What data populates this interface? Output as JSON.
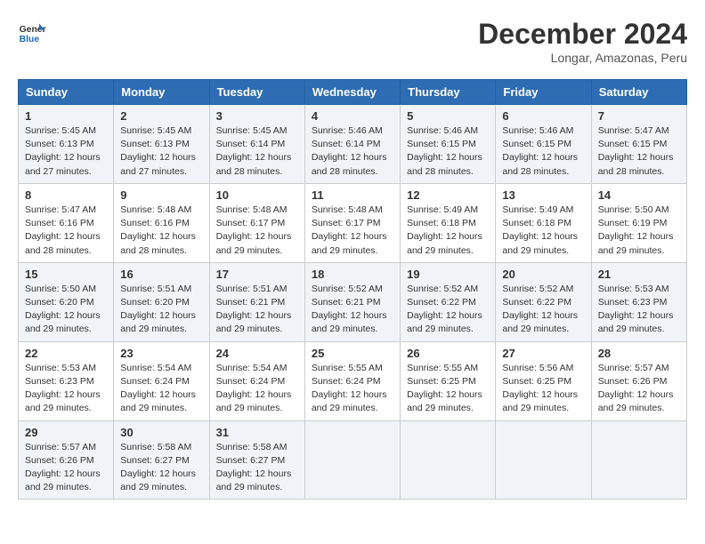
{
  "logo": {
    "line1": "General",
    "line2": "Blue"
  },
  "title": "December 2024",
  "subtitle": "Longar, Amazonas, Peru",
  "days_header": [
    "Sunday",
    "Monday",
    "Tuesday",
    "Wednesday",
    "Thursday",
    "Friday",
    "Saturday"
  ],
  "weeks": [
    [
      {
        "day": "1",
        "info": "Sunrise: 5:45 AM\nSunset: 6:13 PM\nDaylight: 12 hours\nand 27 minutes."
      },
      {
        "day": "2",
        "info": "Sunrise: 5:45 AM\nSunset: 6:13 PM\nDaylight: 12 hours\nand 27 minutes."
      },
      {
        "day": "3",
        "info": "Sunrise: 5:45 AM\nSunset: 6:14 PM\nDaylight: 12 hours\nand 28 minutes."
      },
      {
        "day": "4",
        "info": "Sunrise: 5:46 AM\nSunset: 6:14 PM\nDaylight: 12 hours\nand 28 minutes."
      },
      {
        "day": "5",
        "info": "Sunrise: 5:46 AM\nSunset: 6:15 PM\nDaylight: 12 hours\nand 28 minutes."
      },
      {
        "day": "6",
        "info": "Sunrise: 5:46 AM\nSunset: 6:15 PM\nDaylight: 12 hours\nand 28 minutes."
      },
      {
        "day": "7",
        "info": "Sunrise: 5:47 AM\nSunset: 6:15 PM\nDaylight: 12 hours\nand 28 minutes."
      }
    ],
    [
      {
        "day": "8",
        "info": "Sunrise: 5:47 AM\nSunset: 6:16 PM\nDaylight: 12 hours\nand 28 minutes."
      },
      {
        "day": "9",
        "info": "Sunrise: 5:48 AM\nSunset: 6:16 PM\nDaylight: 12 hours\nand 28 minutes."
      },
      {
        "day": "10",
        "info": "Sunrise: 5:48 AM\nSunset: 6:17 PM\nDaylight: 12 hours\nand 29 minutes."
      },
      {
        "day": "11",
        "info": "Sunrise: 5:48 AM\nSunset: 6:17 PM\nDaylight: 12 hours\nand 29 minutes."
      },
      {
        "day": "12",
        "info": "Sunrise: 5:49 AM\nSunset: 6:18 PM\nDaylight: 12 hours\nand 29 minutes."
      },
      {
        "day": "13",
        "info": "Sunrise: 5:49 AM\nSunset: 6:18 PM\nDaylight: 12 hours\nand 29 minutes."
      },
      {
        "day": "14",
        "info": "Sunrise: 5:50 AM\nSunset: 6:19 PM\nDaylight: 12 hours\nand 29 minutes."
      }
    ],
    [
      {
        "day": "15",
        "info": "Sunrise: 5:50 AM\nSunset: 6:20 PM\nDaylight: 12 hours\nand 29 minutes."
      },
      {
        "day": "16",
        "info": "Sunrise: 5:51 AM\nSunset: 6:20 PM\nDaylight: 12 hours\nand 29 minutes."
      },
      {
        "day": "17",
        "info": "Sunrise: 5:51 AM\nSunset: 6:21 PM\nDaylight: 12 hours\nand 29 minutes."
      },
      {
        "day": "18",
        "info": "Sunrise: 5:52 AM\nSunset: 6:21 PM\nDaylight: 12 hours\nand 29 minutes."
      },
      {
        "day": "19",
        "info": "Sunrise: 5:52 AM\nSunset: 6:22 PM\nDaylight: 12 hours\nand 29 minutes."
      },
      {
        "day": "20",
        "info": "Sunrise: 5:52 AM\nSunset: 6:22 PM\nDaylight: 12 hours\nand 29 minutes."
      },
      {
        "day": "21",
        "info": "Sunrise: 5:53 AM\nSunset: 6:23 PM\nDaylight: 12 hours\nand 29 minutes."
      }
    ],
    [
      {
        "day": "22",
        "info": "Sunrise: 5:53 AM\nSunset: 6:23 PM\nDaylight: 12 hours\nand 29 minutes."
      },
      {
        "day": "23",
        "info": "Sunrise: 5:54 AM\nSunset: 6:24 PM\nDaylight: 12 hours\nand 29 minutes."
      },
      {
        "day": "24",
        "info": "Sunrise: 5:54 AM\nSunset: 6:24 PM\nDaylight: 12 hours\nand 29 minutes."
      },
      {
        "day": "25",
        "info": "Sunrise: 5:55 AM\nSunset: 6:24 PM\nDaylight: 12 hours\nand 29 minutes."
      },
      {
        "day": "26",
        "info": "Sunrise: 5:55 AM\nSunset: 6:25 PM\nDaylight: 12 hours\nand 29 minutes."
      },
      {
        "day": "27",
        "info": "Sunrise: 5:56 AM\nSunset: 6:25 PM\nDaylight: 12 hours\nand 29 minutes."
      },
      {
        "day": "28",
        "info": "Sunrise: 5:57 AM\nSunset: 6:26 PM\nDaylight: 12 hours\nand 29 minutes."
      }
    ],
    [
      {
        "day": "29",
        "info": "Sunrise: 5:57 AM\nSunset: 6:26 PM\nDaylight: 12 hours\nand 29 minutes."
      },
      {
        "day": "30",
        "info": "Sunrise: 5:58 AM\nSunset: 6:27 PM\nDaylight: 12 hours\nand 29 minutes."
      },
      {
        "day": "31",
        "info": "Sunrise: 5:58 AM\nSunset: 6:27 PM\nDaylight: 12 hours\nand 29 minutes."
      },
      null,
      null,
      null,
      null
    ]
  ]
}
